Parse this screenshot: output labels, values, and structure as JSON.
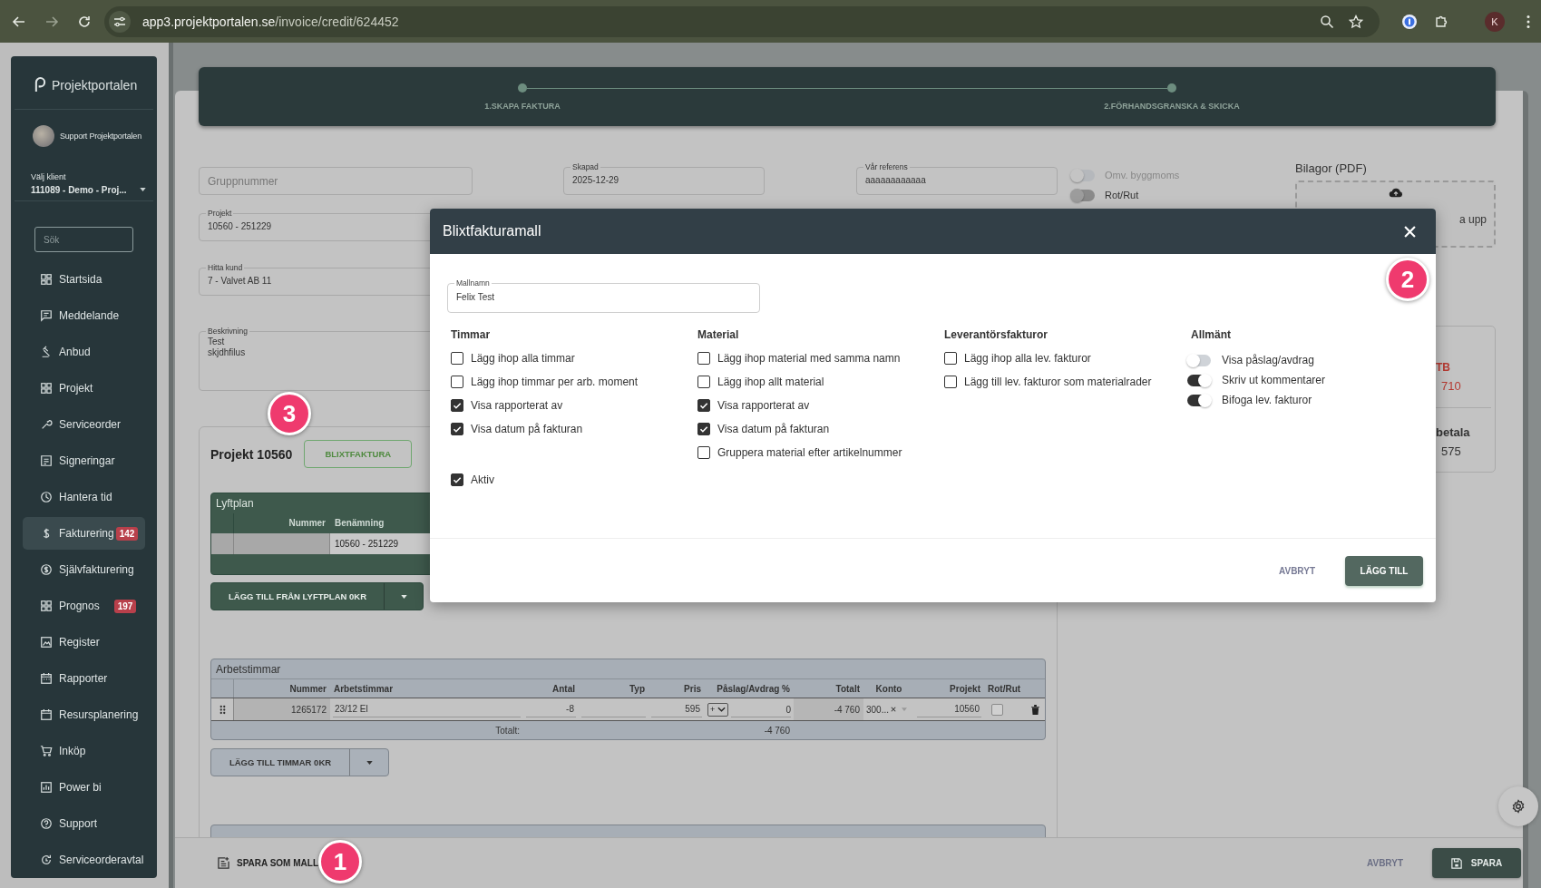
{
  "browser": {
    "url_host": "app3.projektportalen.se",
    "url_path": "/invoice/credit/624452",
    "profile": "K"
  },
  "sidebar": {
    "brand": "Projektportalen",
    "user": "Support Projektportalen",
    "client_label": "Välj klient",
    "client_value": "111089 - Demo - Proj...",
    "search_placeholder": "Sök",
    "items": [
      {
        "label": "Startsida",
        "selected": false
      },
      {
        "label": "Meddelande",
        "selected": false
      },
      {
        "label": "Anbud",
        "selected": false
      },
      {
        "label": "Projekt",
        "selected": false
      },
      {
        "label": "Serviceorder",
        "selected": false
      },
      {
        "label": "Signeringar",
        "selected": false
      },
      {
        "label": "Hantera tid",
        "selected": false
      },
      {
        "label": "Fakturering",
        "selected": true,
        "badge": "142"
      },
      {
        "label": "Självfakturering",
        "selected": false
      },
      {
        "label": "Prognos",
        "selected": false,
        "badge": "197"
      },
      {
        "label": "Register",
        "selected": false
      },
      {
        "label": "Rapporter",
        "selected": false
      },
      {
        "label": "Resursplanering",
        "selected": false
      },
      {
        "label": "Inköp",
        "selected": false
      },
      {
        "label": "Power bi",
        "selected": false
      },
      {
        "label": "Support",
        "selected": false
      },
      {
        "label": "Serviceorderavtal",
        "selected": false
      }
    ]
  },
  "stepper": {
    "steps": [
      "1.SKAPA FAKTURA",
      "2.FÖRHANDSGRANSKA & SKICKA"
    ]
  },
  "invoice_form": {
    "group_number": {
      "placeholder": "Gruppnummer"
    },
    "created": {
      "label": "Skapad",
      "value": "2025-12-29"
    },
    "our_reference": {
      "label": "Vår referens",
      "value": "aaaaaaaaaaaa"
    },
    "project": {
      "label": "Projekt",
      "value": "10560 - 251229"
    },
    "customer": {
      "label": "Hitta kund",
      "value": "7 - Valvet AB 11"
    },
    "description": {
      "label": "Beskrivning",
      "value": "Test\nskjdhfilus"
    },
    "toggles": [
      {
        "label": "Omv. byggmoms",
        "on": false,
        "disabled": true
      },
      {
        "label": "Rot/Rut",
        "on": false,
        "disabled": false
      }
    ],
    "attachments": {
      "title": "Bilagor (PDF)",
      "upload_text": "a upp"
    }
  },
  "summary": {
    "sections": [
      [
        {
          "text": "TB",
          "kind": "label",
          "negative": true
        },
        {
          "text": "710",
          "kind": "value",
          "negative": true
        }
      ],
      [
        {
          "text": "betala",
          "kind": "label",
          "negative": false
        },
        {
          "text": "575",
          "kind": "value",
          "negative": false
        }
      ]
    ]
  },
  "project_section": {
    "title": "Projekt 10560",
    "template_button": "BLIXTFAKTURA",
    "lift_plan": {
      "title": "Lyftplan",
      "columns": [
        "Nummer",
        "Benämning"
      ],
      "rows": [
        {
          "name": "10560 - 251229"
        }
      ],
      "add_button": "LÄGG TILL FRÅN LYFTPLAN 0KR"
    },
    "hours": {
      "title": "Arbetstimmar",
      "columns": [
        "Nummer",
        "Arbetstimmar",
        "Antal",
        "Typ",
        "Pris",
        "Påslag/Avdrag %",
        "Totalt",
        "Konto",
        "Projekt",
        "Rot/Rut"
      ],
      "rows": [
        {
          "number": "1265172",
          "name": "23/12 El",
          "quantity": "-8",
          "price": "595",
          "markup_sign": "+",
          "markup": "0",
          "total": "-4 760",
          "account": "300...",
          "project": "10560",
          "rot_rut": false
        }
      ],
      "total_label": "Totalt:",
      "total_value": "-4 760",
      "add_button": "LÄGG TILL TIMMAR 0KR"
    }
  },
  "footer": {
    "save_template": "SPARA SOM MALL",
    "cancel": "AVBRYT",
    "save": "SPARA"
  },
  "modal": {
    "title": "Blixtfakturamall",
    "name_field": {
      "label": "Mallnamn",
      "value": "Felix Test"
    },
    "groups": [
      {
        "title": "Timmar",
        "options": [
          {
            "kind": "checkbox",
            "label": "Lägg ihop alla timmar",
            "checked": false
          },
          {
            "kind": "checkbox",
            "label": "Lägg ihop timmar per arb. moment",
            "checked": false
          },
          {
            "kind": "checkbox",
            "label": "Visa rapporterat av",
            "checked": true
          },
          {
            "kind": "checkbox",
            "label": "Visa datum på fakturan",
            "checked": true
          }
        ]
      },
      {
        "title": "Material",
        "options": [
          {
            "kind": "checkbox",
            "label": "Lägg ihop material med samma namn",
            "checked": false
          },
          {
            "kind": "checkbox",
            "label": "Lägg ihop allt material",
            "checked": false
          },
          {
            "kind": "checkbox",
            "label": "Visa rapporterat av",
            "checked": true
          },
          {
            "kind": "checkbox",
            "label": "Visa datum på fakturan",
            "checked": true
          },
          {
            "kind": "checkbox",
            "label": "Gruppera material efter artikelnummer",
            "checked": false
          }
        ]
      },
      {
        "title": "Leverantörsfakturor",
        "options": [
          {
            "kind": "checkbox",
            "label": "Lägg ihop alla lev. fakturor",
            "checked": false
          },
          {
            "kind": "checkbox",
            "label": "Lägg till lev. fakturor som materialrader",
            "checked": false
          }
        ]
      },
      {
        "title": "Allmänt",
        "options": [
          {
            "kind": "toggle",
            "label": "Visa påslag/avdrag",
            "checked": false
          },
          {
            "kind": "toggle",
            "label": "Skriv ut kommentarer",
            "checked": true
          },
          {
            "kind": "toggle",
            "label": "Bifoga lev. fakturor",
            "checked": true
          }
        ]
      }
    ],
    "active": {
      "label": "Aktiv",
      "checked": true
    },
    "cancel": "AVBRYT",
    "submit": "LÄGG TILL"
  },
  "annotations": [
    {
      "number": "1"
    },
    {
      "number": "2"
    },
    {
      "number": "3"
    }
  ]
}
